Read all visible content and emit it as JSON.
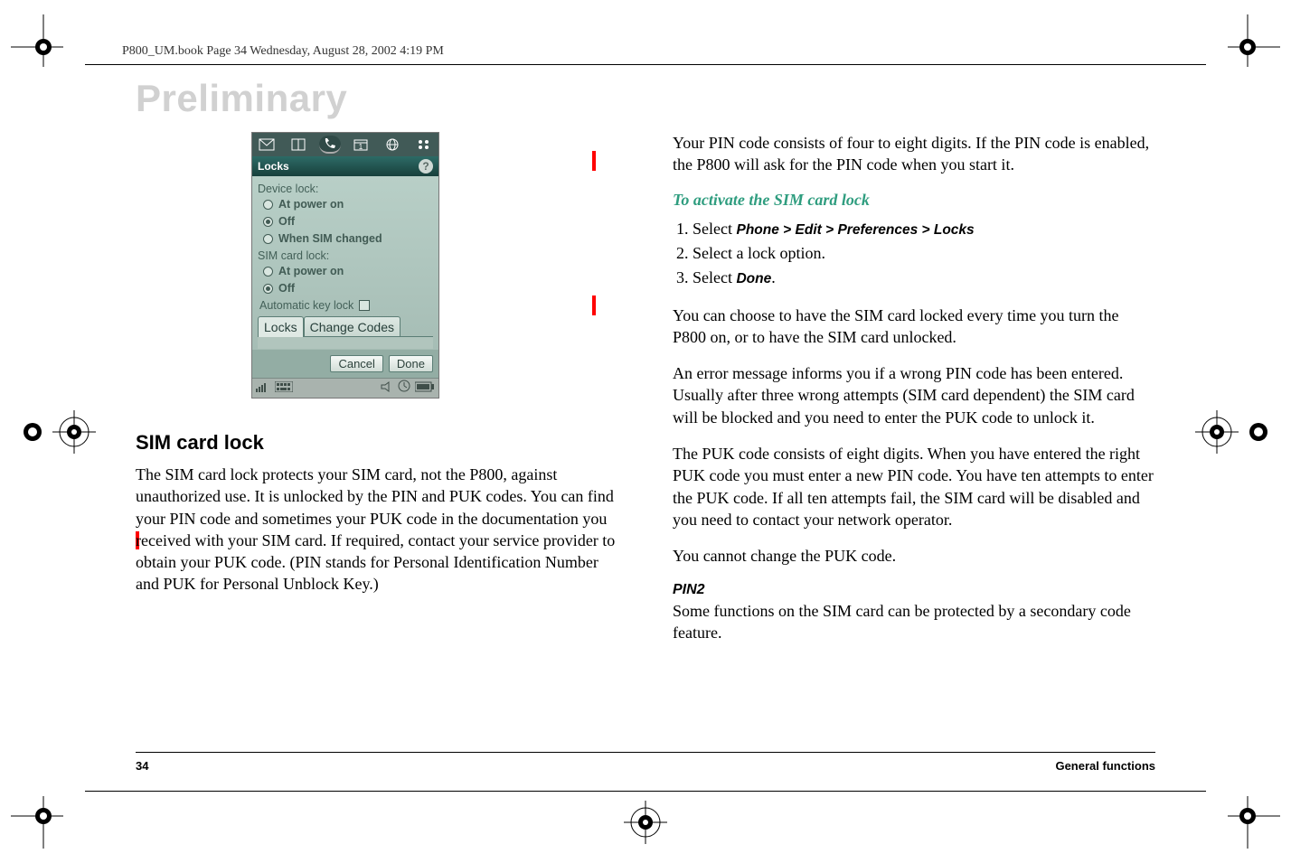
{
  "running_header": "P800_UM.book  Page 34  Wednesday, August 28, 2002  4:19 PM",
  "preliminary": "Preliminary",
  "phone_ui": {
    "title": "Locks",
    "device_lock_label": "Device lock:",
    "device_lock_options": {
      "at_power_on": "At power on",
      "off": "Off",
      "when_sim_changed": "When SIM changed"
    },
    "sim_lock_label": "SIM card lock:",
    "sim_lock_options": {
      "at_power_on": "At power on",
      "off": "Off"
    },
    "auto_keylock": "Automatic key lock",
    "tabs": {
      "locks": "Locks",
      "change_codes": "Change Codes"
    },
    "buttons": {
      "cancel": "Cancel",
      "done": "Done"
    }
  },
  "left_col": {
    "section": "SIM card lock",
    "para1": "The SIM card lock protects your SIM card, not the P800, against unauthorized use. It is unlocked by the PIN and PUK codes. You can find your PIN code and sometimes your PUK code in the documentation you received with your SIM card. If required, contact your service provider to obtain your PUK code. (PIN stands for Personal Identification Number and PUK for Personal Unblock Key.)"
  },
  "right_col": {
    "para1": "Your PIN code consists of four to eight digits. If the PIN code is enabled, the P800 will ask for the PIN code when you start it.",
    "activate_heading": "To activate the SIM card lock",
    "step1_prefix": "Select ",
    "step1_bold": "Phone > Edit > Preferences > Locks",
    "step2": "Select a lock option.",
    "step3_prefix": "Select ",
    "step3_bold": "Done",
    "step3_suffix": ".",
    "para2": "You can choose to have the SIM card locked every time you turn the P800 on, or to have the SIM card unlocked.",
    "para3": "An error message informs you if a wrong PIN code has been entered. Usually after three wrong attempts (SIM card dependent) the SIM card will be blocked and you need to enter the PUK code to unlock it.",
    "para4": "The PUK code consists of eight digits. When you have entered the right PUK code you must enter a new PIN code. You have ten attempts to enter the PUK code. If all ten attempts fail, the SIM card will be disabled and you need to contact your network operator.",
    "para5": "You cannot change the PUK code.",
    "pin2_heading": "PIN2",
    "pin2_para": "Some functions on the SIM card can be protected by a secondary code feature."
  },
  "footer": {
    "page": "34",
    "label": "General functions"
  }
}
